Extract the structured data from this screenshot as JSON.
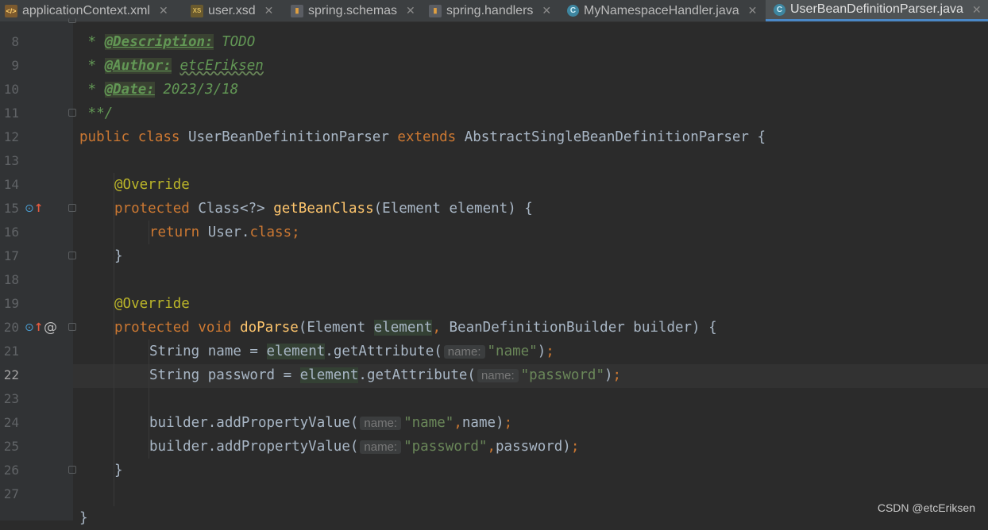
{
  "tabs": [
    {
      "label": "applicationContext.xml",
      "icon": "xml-file-icon"
    },
    {
      "label": "user.xsd",
      "icon": "xsd-file-icon"
    },
    {
      "label": "spring.schemas",
      "icon": "properties-file-icon"
    },
    {
      "label": "spring.handlers",
      "icon": "properties-file-icon"
    },
    {
      "label": "MyNamespaceHandler.java",
      "icon": "java-class-icon"
    },
    {
      "label": "UserBeanDefinitionParser.java",
      "icon": "java-class-icon"
    }
  ],
  "editor": {
    "line_numbers": [
      "8",
      "9",
      "10",
      "11",
      "12",
      "13",
      "14",
      "15",
      "16",
      "17",
      "18",
      "19",
      "20",
      "21",
      "22",
      "23",
      "24",
      "25",
      "26",
      "27"
    ],
    "current_line": "22",
    "code": {
      "l8_star": " * ",
      "l8_tag": "@Description:",
      "l8_text": " TODO",
      "l9_star": " * ",
      "l9_tag": "@Author:",
      "l9_text": " ",
      "l9_name": "etcEriksen",
      "l10_star": " * ",
      "l10_tag": "@Date:",
      "l10_text": " 2023/3/18",
      "l11": " **/",
      "l12_kw1": "public",
      "l12_kw2": "class",
      "l12_name": "UserBeanDefinitionParser",
      "l12_kw3": "extends",
      "l12_rest": "AbstractSingleBeanDefinitionParser {",
      "l14": "@Override",
      "l15_kw": "protected",
      "l15_type": " Class<?> ",
      "l15_fn": "getBeanClass",
      "l15_rest": "(Element element) {",
      "l16_kw": "return",
      "l16_mid": " User.",
      "l16_kw2": "class;",
      "l17": "}",
      "l19": "@Override",
      "l20_kw1": "protected",
      "l20_kw2": "void",
      "l20_fn": "doParse",
      "l20_a": "(Element ",
      "l20_hl": "element",
      "l20_comma": ",",
      "l20_rest": " BeanDefinitionBuilder builder) {",
      "l21_a": "String name = ",
      "l21_hl": "element",
      "l21_b": ".getAttribute(",
      "l21_hint": "name:",
      "l21_str": "\"name\"",
      "l21_end": ")",
      "l21_semi": ";",
      "l22_a": "String password = ",
      "l22_hl1": "e",
      "l22_hl2": "lement",
      "l22_b": ".getAttribute(",
      "l22_hint": "name:",
      "l22_str": "\"password\"",
      "l22_end": ")",
      "l22_semi": ";",
      "l24_a": "builder.addPropertyValue(",
      "l24_hint": "name:",
      "l24_str": "\"name\"",
      "l24_comma": ",",
      "l24_b": "name)",
      "l24_semi": ";",
      "l25_a": "builder.addPropertyValue(",
      "l25_hint": "name:",
      "l25_str": "\"password\"",
      "l25_comma": ",",
      "l25_b": "password)",
      "l25_semi": ";",
      "l26": "}",
      "l28": "}"
    }
  },
  "watermark": "CSDN @etcEriksen"
}
